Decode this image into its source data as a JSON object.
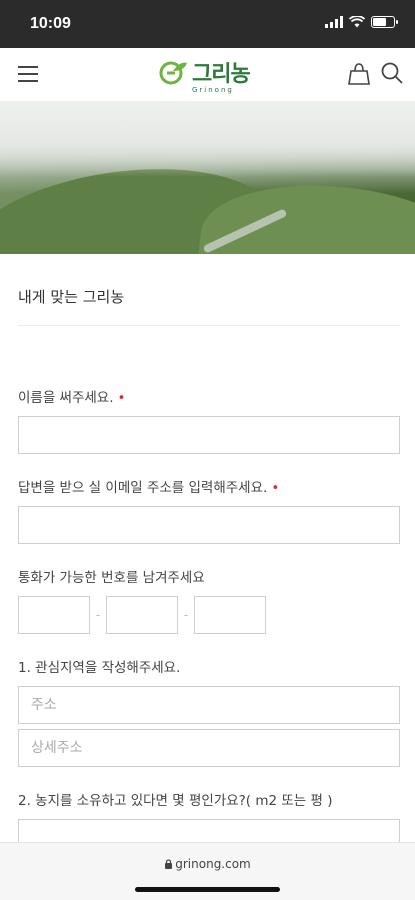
{
  "status": {
    "time": "10:09"
  },
  "header": {
    "logo_text": "그리농",
    "logo_sub": "Grinong"
  },
  "page": {
    "title": "내게 맞는 그리농"
  },
  "form": {
    "name_label": "이름을 써주세요.",
    "email_label": "답변을 받으 실 이메일 주소를 입력해주세요.",
    "phone_label": "통화가 가능한 번호를 남겨주세요",
    "phone_sep": "-",
    "region_label": "1. 관심지역을 작성해주세요.",
    "address_placeholder": "주소",
    "address_detail_placeholder": "상세주소",
    "land_label": "2. 농지를 소유하고 있다면 몇 평인가요?( m2 또는 평 )",
    "required_mark": "•"
  },
  "browser": {
    "url": "grinong.com"
  },
  "colors": {
    "brand": "#2d7a3a",
    "required": "#e02b2b"
  }
}
